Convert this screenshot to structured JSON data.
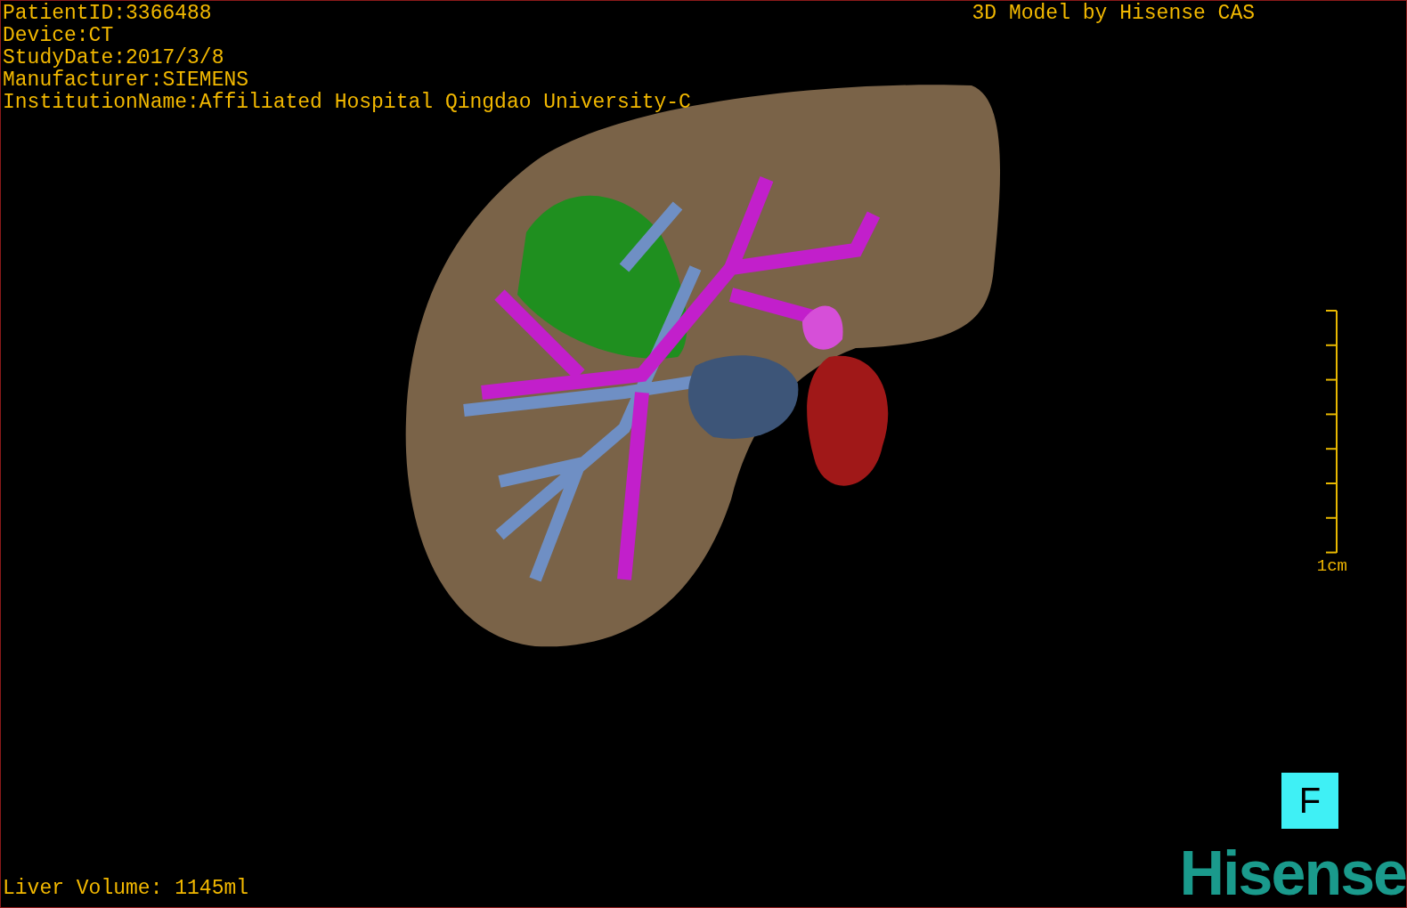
{
  "info_lines": [
    "PatientID:3366488",
    "Device:CT",
    "StudyDate:2017/3/8",
    "Manufacturer:SIEMENS",
    "InstitutionName:Affiliated Hospital Qingdao University-C"
  ],
  "title": "3D Model by Hisense CAS",
  "scale_bar": {
    "label": "1cm"
  },
  "view_button": "F",
  "liver_volume": "Liver Volume: 1145ml",
  "logo": "Hisense"
}
